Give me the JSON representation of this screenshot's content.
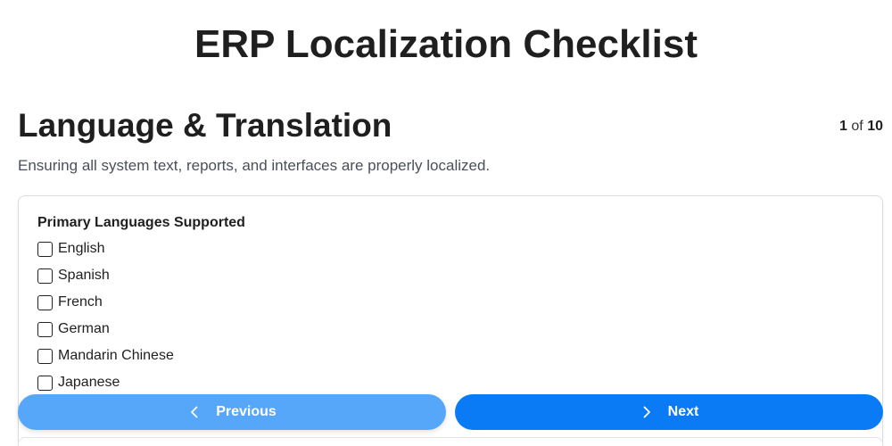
{
  "page": {
    "title": "ERP Localization Checklist"
  },
  "section": {
    "title": "Language & Translation",
    "description": "Ensuring all system text, reports, and interfaces are properly localized.",
    "pager": {
      "current": "1",
      "of_label": "of",
      "total": "10"
    }
  },
  "question": {
    "label": "Primary Languages Supported",
    "options": [
      {
        "label": "English",
        "checked": false
      },
      {
        "label": "Spanish",
        "checked": false
      },
      {
        "label": "French",
        "checked": false
      },
      {
        "label": "German",
        "checked": false
      },
      {
        "label": "Mandarin Chinese",
        "checked": false
      },
      {
        "label": "Japanese",
        "checked": false
      }
    ]
  },
  "navigation": {
    "previous_label": "Previous",
    "previous_icon": "chevron-left-icon",
    "next_label": "Next",
    "next_icon": "chevron-right-icon"
  },
  "colors": {
    "previous_button": "#56a7f9",
    "next_button": "#0a7bf5"
  }
}
